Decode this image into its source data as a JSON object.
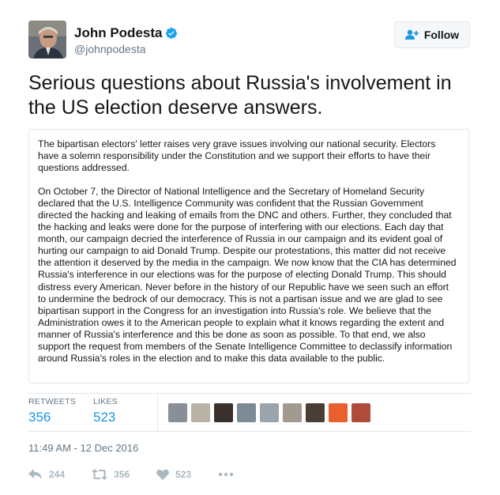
{
  "author": {
    "name": "John Podesta",
    "handle": "@johnpodesta",
    "verified": true
  },
  "follow": {
    "label": "Follow"
  },
  "tweet": {
    "text": "Serious questions about Russia's involvement in the US election deserve answers."
  },
  "letter": {
    "paragraph_1": "The bipartisan electors' letter raises very grave issues involving our national security.  Electors have a solemn responsibility under the Constitution and we support their efforts to have their questions addressed.",
    "paragraph_2": "On October 7, the Director of National Intelligence and the Secretary of Homeland Security declared that the U.S. Intelligence Community was confident that the Russian Government directed the hacking and leaking of emails from the DNC and others.   Further, they concluded that the hacking and leaks were done for the purpose of interfering with our elections.  Each day that month, our campaign decried the interference of Russia in our campaign and its evident goal of hurting our campaign to aid Donald Trump.  Despite our protestations, this matter did not receive the attention it deserved by the media in the campaign.  We now know that the CIA has determined Russia's interference in our elections was for the purpose of electing Donald Trump.  This should distress every American.  Never before in the history of our Republic have we seen such an effort to undermine the bedrock of our democracy. This is not a partisan issue and we are glad to see bipartisan support in the Congress for an investigation into Russia's role.  We believe that the Administration owes it to the American people to explain what it knows regarding the extent and manner of Russia's interference and this be done as soon as possible. To that end, we also support the request from members of the Senate Intelligence Committee to declassify information around Russia's roles in the election and to make this data available to the public."
  },
  "stats": {
    "retweets_label": "RETWEETS",
    "retweets_value": "356",
    "likes_label": "LIKES",
    "likes_value": "523"
  },
  "likers": [
    {
      "name": "liker-avatar-1",
      "color": "#8a8f97"
    },
    {
      "name": "liker-avatar-2",
      "color": "#b9b2a6"
    },
    {
      "name": "liker-avatar-3",
      "color": "#3a302c"
    },
    {
      "name": "liker-avatar-4",
      "color": "#7c8b94"
    },
    {
      "name": "liker-avatar-5",
      "color": "#9aa4ad"
    },
    {
      "name": "liker-avatar-6",
      "color": "#a39a8f"
    },
    {
      "name": "liker-avatar-7",
      "color": "#4a3d34"
    },
    {
      "name": "liker-avatar-8",
      "color": "#e8612c"
    },
    {
      "name": "liker-avatar-9",
      "color": "#b04a3a"
    }
  ],
  "timestamp": "11:49 AM - 12 Dec 2016",
  "actions": {
    "reply_count": "244",
    "retweet_count": "356",
    "like_count": "523"
  },
  "colors": {
    "accent": "#1b95e0",
    "muted": "#657786",
    "icon_muted": "#aab8c2",
    "border": "#e1e8ed"
  }
}
